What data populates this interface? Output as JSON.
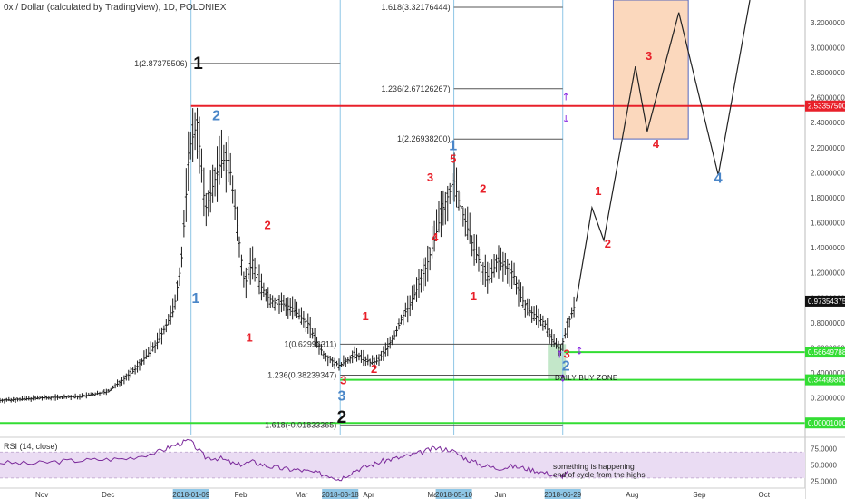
{
  "header": {
    "title": "0x / Dollar (calculated by TradingView), 1D, POLONIEX"
  },
  "colors": {
    "red_line": "#e8202a",
    "green_line": "#33dd33",
    "blue_vline": "#8ec6e6",
    "label_red": "#e8202a",
    "label_blue": "#4a86c8",
    "label_black": "#111111",
    "rsi_line": "#7b2a9b",
    "rsi_band": "#eadcf3",
    "buy_zone": "#b9e3bf",
    "target_box": "#fbd8bd",
    "target_box_border": "#5566bb"
  },
  "chart_data": {
    "type": "line",
    "title": "0x / Dollar (calculated by TradingView), 1D, POLONIEX",
    "ylim": [
      0.1,
      3.38
    ],
    "x_axis_labels": [
      {
        "label": "Nov",
        "x": 2017.833
      },
      {
        "label": "Dec",
        "x": 2017.917
      },
      {
        "label": "2018-01-09",
        "x": 2018.022,
        "highlight": true
      },
      {
        "label": "Feb",
        "x": 2018.085
      },
      {
        "label": "Mar",
        "x": 2018.162
      },
      {
        "label": "2018-03-18",
        "x": 2018.211,
        "highlight": true
      },
      {
        "label": "Apr",
        "x": 2018.247
      },
      {
        "label": "Ma",
        "x": 2018.328
      },
      {
        "label": "2018-05-10",
        "x": 2018.355,
        "highlight": true
      },
      {
        "label": "Jun",
        "x": 2018.414
      },
      {
        "label": "2018-06-29",
        "x": 2018.493,
        "highlight": true
      },
      {
        "label": "Aug",
        "x": 2018.581
      },
      {
        "label": "Sep",
        "x": 2018.666
      },
      {
        "label": "Oct",
        "x": 2018.748
      }
    ],
    "y_ticks": [
      "3.20000000",
      "3.00000000",
      "2.80000000",
      "2.60000000",
      "2.40000000",
      "2.20000000",
      "2.00000000",
      "1.80000000",
      "1.60000000",
      "1.40000000",
      "1.20000000",
      "1.00000000",
      "0.80000000",
      "0.60000000",
      "0.40000000",
      "0.20000000"
    ],
    "y_tick_values": [
      3.2,
      3.0,
      2.8,
      2.6,
      2.4,
      2.2,
      2.0,
      1.8,
      1.6,
      1.4,
      1.2,
      1.0,
      0.8,
      0.6,
      0.4,
      0.2
    ],
    "price_tags": [
      {
        "label": "2.53357500",
        "value": 2.533575,
        "color": "#e8202a"
      },
      {
        "label": "0.97354375",
        "value": 0.973544,
        "color": "#111111"
      },
      {
        "label": "0.56649788",
        "value": 0.566498,
        "color": "#33dd33"
      },
      {
        "label": "0.34499800",
        "value": 0.344998,
        "color": "#33dd33"
      },
      {
        "label": "0.00001000",
        "value": 1e-05,
        "color": "#33dd33"
      }
    ],
    "horizontal_lines": [
      {
        "value": 2.533575,
        "color": "#e8202a",
        "x_from": 2018.022,
        "x_to": 2018.8
      },
      {
        "value": 0.566498,
        "color": "#33dd33",
        "x_from": 2018.495,
        "x_to": 2018.8
      },
      {
        "value": 0.344998,
        "color": "#33dd33",
        "x_from": 2018.211,
        "x_to": 2018.8
      },
      {
        "value": 1e-05,
        "color": "#33dd33",
        "x_from": 2017.78,
        "x_to": 2018.8
      }
    ],
    "fib_levels": [
      {
        "label": "1(2.87375506)",
        "value": 2.87375506,
        "x_from": 2018.022,
        "x_to": 2018.211
      },
      {
        "label": "1.618(3.32176444)",
        "value": 3.32176444,
        "x_from": 2018.355,
        "x_to": 2018.493
      },
      {
        "label": "1.236(2.67126267)",
        "value": 2.67126267,
        "x_from": 2018.355,
        "x_to": 2018.493
      },
      {
        "label": "1(2.26938200)",
        "value": 2.269382,
        "x_from": 2018.355,
        "x_to": 2018.493
      },
      {
        "label": "1(0.62996311)",
        "value": 0.62996311,
        "x_from": 2018.211,
        "x_to": 2018.493
      },
      {
        "label": "1.236(0.38239347)",
        "value": 0.38239347,
        "x_from": 2018.211,
        "x_to": 2018.493
      },
      {
        "label": "1.618(-0.01833365)",
        "value": -0.01833365,
        "x_from": 2018.211,
        "x_to": 2018.493
      }
    ],
    "vertical_lines": [
      2018.022,
      2018.211,
      2018.355,
      2018.493
    ],
    "price_series": {
      "name": "",
      "x": [
        2017.78,
        2017.83,
        2017.88,
        2017.917,
        2017.95,
        2017.98,
        2018.0,
        2018.01,
        2018.02,
        2018.03,
        2018.04,
        2018.05,
        2018.06,
        2018.07,
        2018.08,
        2018.09,
        2018.1,
        2018.11,
        2018.12,
        2018.13,
        2018.14,
        2018.15,
        2018.16,
        2018.17,
        2018.18,
        2018.19,
        2018.2,
        2018.21,
        2018.22,
        2018.23,
        2018.24,
        2018.25,
        2018.26,
        2018.27,
        2018.28,
        2018.29,
        2018.3,
        2018.31,
        2018.32,
        2018.33,
        2018.34,
        2018.35,
        2018.355,
        2018.36,
        2018.37,
        2018.38,
        2018.39,
        2018.4,
        2018.41,
        2018.42,
        2018.43,
        2018.44,
        2018.45,
        2018.46,
        2018.47,
        2018.48,
        2018.49,
        2018.5,
        2018.51
      ],
      "values": [
        0.18,
        0.2,
        0.21,
        0.25,
        0.42,
        0.65,
        0.9,
        1.3,
        2.2,
        2.4,
        1.7,
        1.9,
        2.1,
        2.1,
        1.6,
        1.1,
        1.3,
        1.1,
        1.0,
        0.95,
        0.95,
        0.92,
        0.85,
        0.8,
        0.66,
        0.55,
        0.5,
        0.46,
        0.5,
        0.55,
        0.52,
        0.48,
        0.5,
        0.6,
        0.7,
        0.85,
        0.95,
        1.1,
        1.25,
        1.45,
        1.7,
        1.85,
        1.95,
        1.8,
        1.6,
        1.4,
        1.25,
        1.15,
        1.3,
        1.25,
        1.2,
        1.0,
        0.9,
        0.85,
        0.8,
        0.65,
        0.58,
        0.8,
        0.97
      ]
    },
    "projection": {
      "x": [
        2018.51,
        2018.53,
        2018.545,
        2018.585,
        2018.6,
        2018.64,
        2018.69,
        2018.73
      ],
      "values": [
        0.97,
        1.72,
        1.46,
        2.85,
        2.33,
        3.28,
        1.98,
        3.38
      ]
    },
    "buy_zone": {
      "label": "DAILY BUY ZONE",
      "x_from": 2018.474,
      "x_to": 2018.497,
      "y_from": 0.344998,
      "y_to": 0.62996311
    },
    "target_box": {
      "x_from": 2018.557,
      "x_to": 2018.652,
      "y_from": 2.27,
      "y_to": 3.38
    },
    "wave_labels": [
      {
        "text": "1",
        "x": 2018.031,
        "value": 2.83,
        "color": "black"
      },
      {
        "text": "2",
        "x": 2018.054,
        "value": 2.42,
        "color": "blue"
      },
      {
        "text": "1",
        "x": 2018.028,
        "value": 0.96,
        "color": "blue"
      },
      {
        "text": "2",
        "x": 2018.119,
        "value": 1.55,
        "color": "red"
      },
      {
        "text": "1",
        "x": 2018.096,
        "value": 0.65,
        "color": "red"
      },
      {
        "text": "3",
        "x": 2018.215,
        "value": 0.31,
        "color": "red"
      },
      {
        "text": "3",
        "x": 2018.213,
        "value": 0.18,
        "color": "blue"
      },
      {
        "text": "2",
        "x": 2018.213,
        "value": 0.0,
        "color": "black"
      },
      {
        "text": "1",
        "x": 2018.243,
        "value": 0.82,
        "color": "red"
      },
      {
        "text": "2",
        "x": 2018.254,
        "value": 0.4,
        "color": "red"
      },
      {
        "text": "3",
        "x": 2018.325,
        "value": 1.93,
        "color": "red"
      },
      {
        "text": "4",
        "x": 2018.331,
        "value": 1.45,
        "color": "red"
      },
      {
        "text": "5",
        "x": 2018.354,
        "value": 2.08,
        "color": "red"
      },
      {
        "text": "1",
        "x": 2018.354,
        "value": 2.18,
        "color": "blue"
      },
      {
        "text": "2",
        "x": 2018.392,
        "value": 1.84,
        "color": "red"
      },
      {
        "text": "1",
        "x": 2018.38,
        "value": 0.98,
        "color": "red"
      },
      {
        "text": "3",
        "x": 2018.498,
        "value": 0.52,
        "color": "red"
      },
      {
        "text": "2",
        "x": 2018.497,
        "value": 0.42,
        "color": "blue"
      },
      {
        "text": "1",
        "x": 2018.538,
        "value": 1.82,
        "color": "red"
      },
      {
        "text": "2",
        "x": 2018.55,
        "value": 1.4,
        "color": "red"
      },
      {
        "text": "3",
        "x": 2018.602,
        "value": 2.9,
        "color": "red"
      },
      {
        "text": "4",
        "x": 2018.611,
        "value": 2.2,
        "color": "red"
      },
      {
        "text": "4",
        "x": 2018.69,
        "value": 1.92,
        "color": "blue"
      }
    ],
    "arrows": [
      {
        "symbol": "↑",
        "x": 2018.497,
        "value": 2.58
      },
      {
        "symbol": "↓",
        "x": 2018.497,
        "value": 2.4
      },
      {
        "symbol": "↕",
        "x": 2018.514,
        "value": 0.55
      },
      {
        "symbol": "↕",
        "x": 2018.493,
        "value": 0.33
      },
      {
        "symbol": "↑",
        "x": 2018.489,
        "value": 0.52
      }
    ],
    "rsi": {
      "title": "RSI (14, close)",
      "ticks": [
        "75.0000",
        "50.0000",
        "25.0000"
      ],
      "tick_values": [
        75,
        50,
        25
      ],
      "band": [
        30,
        70
      ],
      "x": [
        2017.78,
        2017.82,
        2017.86,
        2017.9,
        2017.94,
        2017.98,
        2018.0,
        2018.02,
        2018.04,
        2018.06,
        2018.08,
        2018.1,
        2018.12,
        2018.14,
        2018.16,
        2018.18,
        2018.2,
        2018.21,
        2018.23,
        2018.25,
        2018.27,
        2018.29,
        2018.31,
        2018.33,
        2018.35,
        2018.37,
        2018.39,
        2018.41,
        2018.43,
        2018.45,
        2018.47,
        2018.49,
        2018.5
      ],
      "values": [
        54,
        52,
        56,
        58,
        60,
        70,
        80,
        88,
        62,
        60,
        50,
        55,
        48,
        44,
        42,
        38,
        33,
        28,
        42,
        50,
        58,
        62,
        68,
        76,
        74,
        60,
        50,
        45,
        48,
        44,
        38,
        32,
        38
      ],
      "note": [
        "something is happening",
        "end of cycle from the highs"
      ]
    }
  }
}
